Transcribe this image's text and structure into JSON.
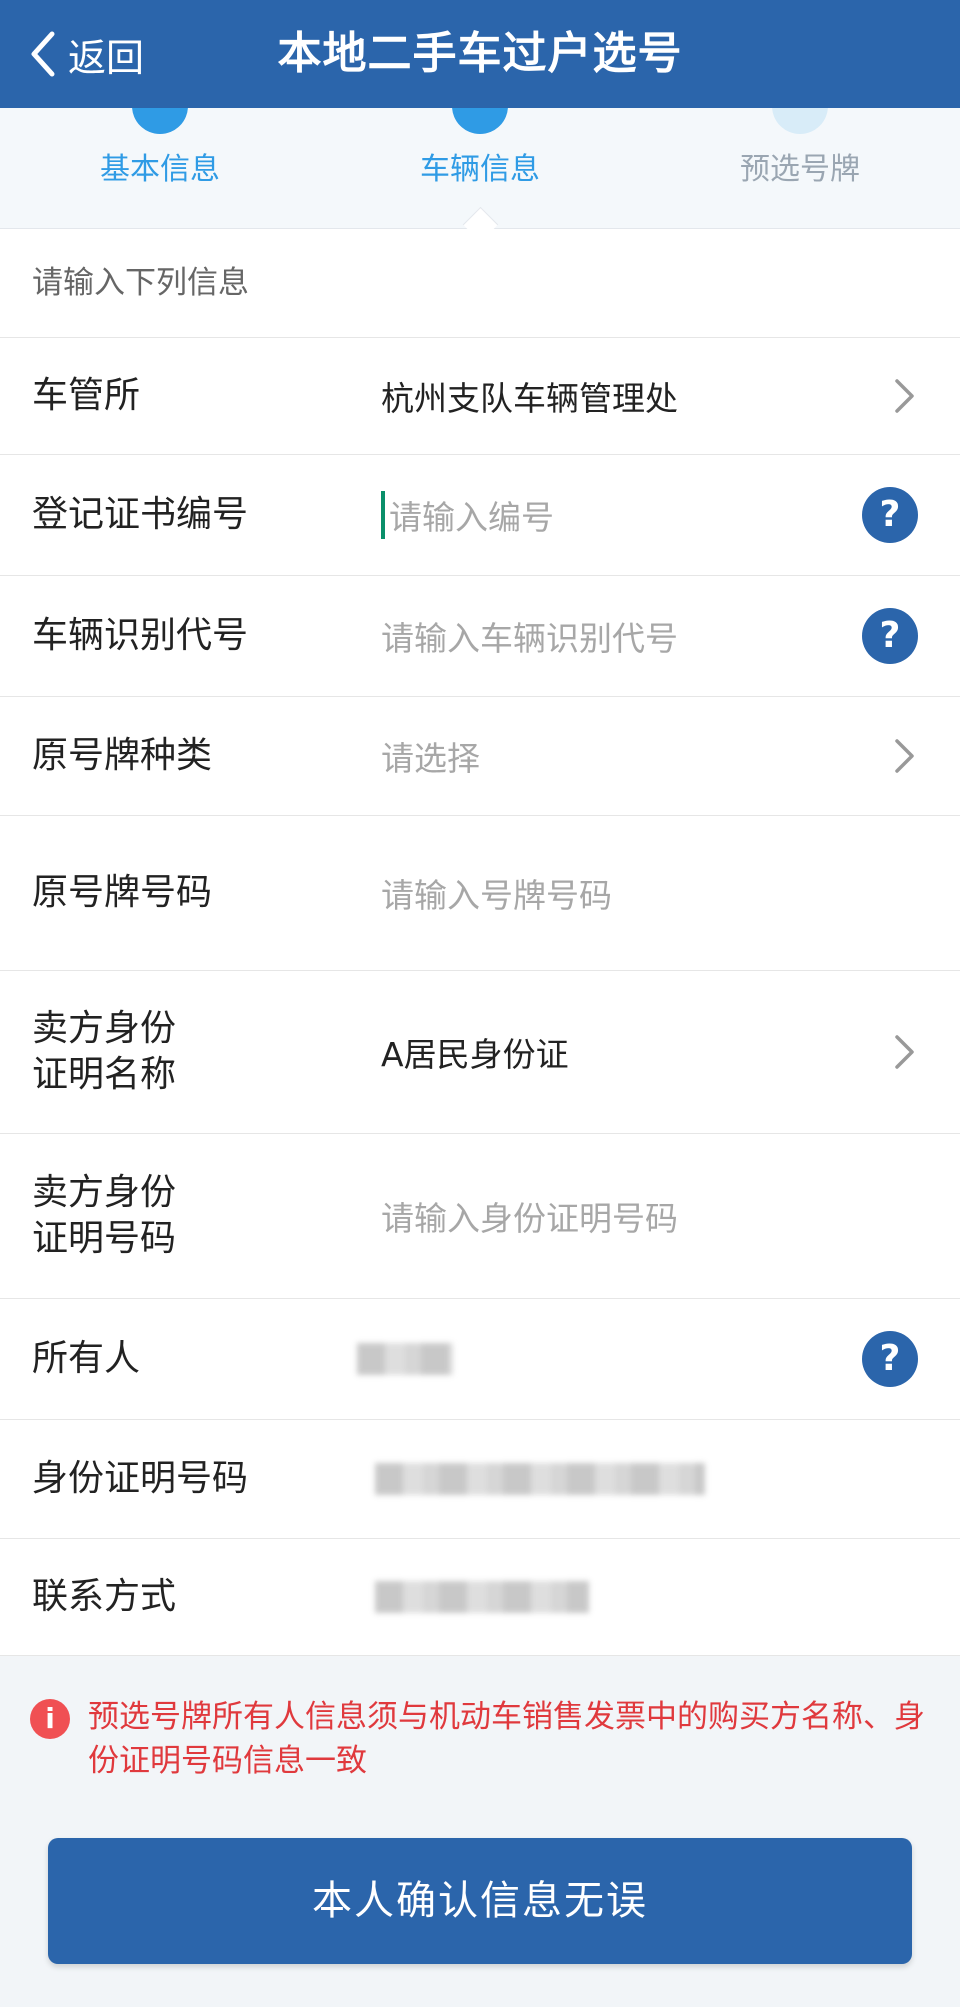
{
  "header": {
    "back_label": "返回",
    "title": "本地二手车过户选号"
  },
  "steps": [
    {
      "label": "基本信息",
      "state": "done"
    },
    {
      "label": "车辆信息",
      "state": "current"
    },
    {
      "label": "预选号牌",
      "state": "todo"
    }
  ],
  "form": {
    "hint": "请输入下列信息",
    "rows": [
      {
        "label": "车管所",
        "value": "杭州支队车辆管理处",
        "type": "select"
      },
      {
        "label": "登记证书编号",
        "placeholder": "请输入编号",
        "type": "input-help"
      },
      {
        "label": "车辆识别代号",
        "placeholder": "请输入车辆识别代号",
        "type": "input-help"
      },
      {
        "label": "原号牌种类",
        "placeholder": "请选择",
        "type": "select"
      },
      {
        "label": "原号牌号码",
        "placeholder": "请输入号牌号码",
        "type": "input"
      },
      {
        "label_line1": "卖方身份",
        "label_line2": "证明名称",
        "value": "A居民身份证",
        "type": "select"
      },
      {
        "label_line1": "卖方身份",
        "label_line2": "证明号码",
        "placeholder": "请输入身份证明号码",
        "type": "input"
      },
      {
        "label": "所有人",
        "type": "redacted-help"
      },
      {
        "label": "身份证明号码",
        "type": "redacted"
      },
      {
        "label": "联系方式",
        "type": "redacted"
      }
    ]
  },
  "warning": {
    "text": "预选号牌所有人信息须与机动车销售发票中的购买方名称、身份证明号码信息一致"
  },
  "confirm_button": {
    "label": "本人确认信息无误"
  },
  "colors": {
    "primary": "#2b65ab",
    "step_active": "#2f9be5",
    "warning": "#e0393d"
  }
}
